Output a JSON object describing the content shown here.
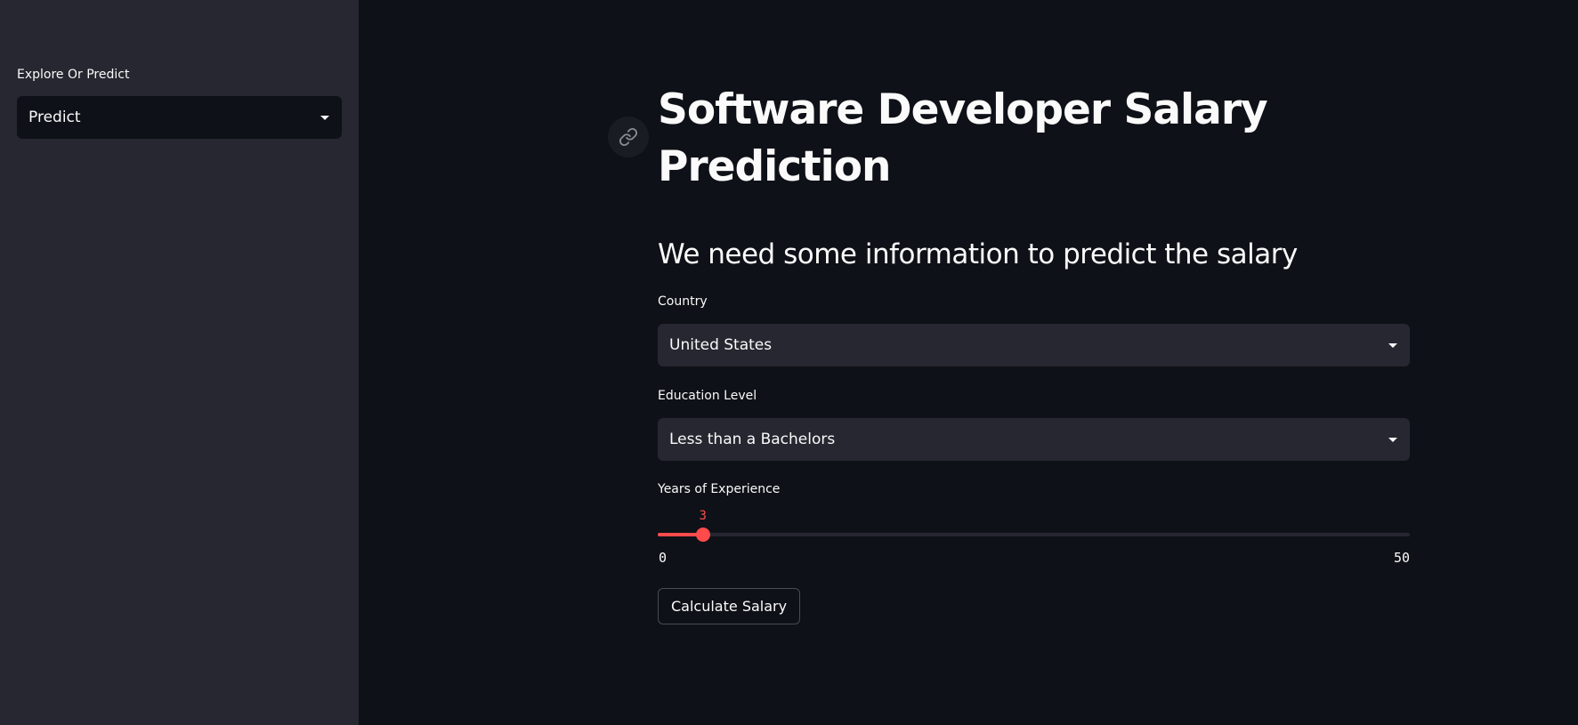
{
  "sidebar": {
    "mode_label": "Explore Or Predict",
    "mode_value": "Predict"
  },
  "main": {
    "title": "Software Developer Salary Prediction",
    "subtitle": "We need some information to predict the salary",
    "country": {
      "label": "Country",
      "value": "United States"
    },
    "education": {
      "label": "Education Level",
      "value": "Less than a Bachelors"
    },
    "experience": {
      "label": "Years of Experience",
      "value": "3",
      "min": "0",
      "max": "50"
    },
    "calculate_button": "Calculate Salary"
  },
  "icons": {
    "anchor": "link-icon",
    "dropdown": "chevron-down-icon"
  },
  "colors": {
    "background": "#0e1117",
    "sidebar": "#262730",
    "accent": "#ff4b4b",
    "text": "#fafafa"
  }
}
